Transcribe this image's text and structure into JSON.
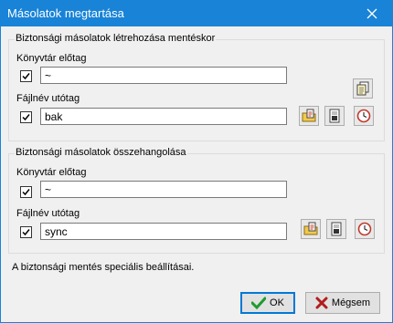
{
  "window": {
    "title": "Másolatok megtartása",
    "close_icon": "close-icon"
  },
  "create_group": {
    "legend": "Biztonsági másolatok létrehozása mentéskor",
    "dir_prefix_label": "Könyvtár előtag",
    "dir_prefix_checked": true,
    "dir_prefix_value": "~",
    "file_suffix_label": "Fájlnév utótag",
    "file_suffix_checked": true,
    "file_suffix_value": "bak",
    "icons": [
      "copy-settings-icon",
      "folder-document-icon",
      "filename-document-icon",
      "clock-icon"
    ]
  },
  "sync_group": {
    "legend": "Biztonsági másolatok összehangolása",
    "dir_prefix_label": "Könyvtár előtag",
    "dir_prefix_checked": true,
    "dir_prefix_value": "~",
    "file_suffix_label": "Fájlnév utótag",
    "file_suffix_checked": true,
    "file_suffix_value": "sync",
    "icons": [
      "folder-document-icon",
      "filename-document-icon",
      "clock-icon"
    ]
  },
  "info_text": "A biztonsági mentés speciális beállításai.",
  "buttons": {
    "ok_label": "OK",
    "cancel_label": "Mégsem"
  }
}
